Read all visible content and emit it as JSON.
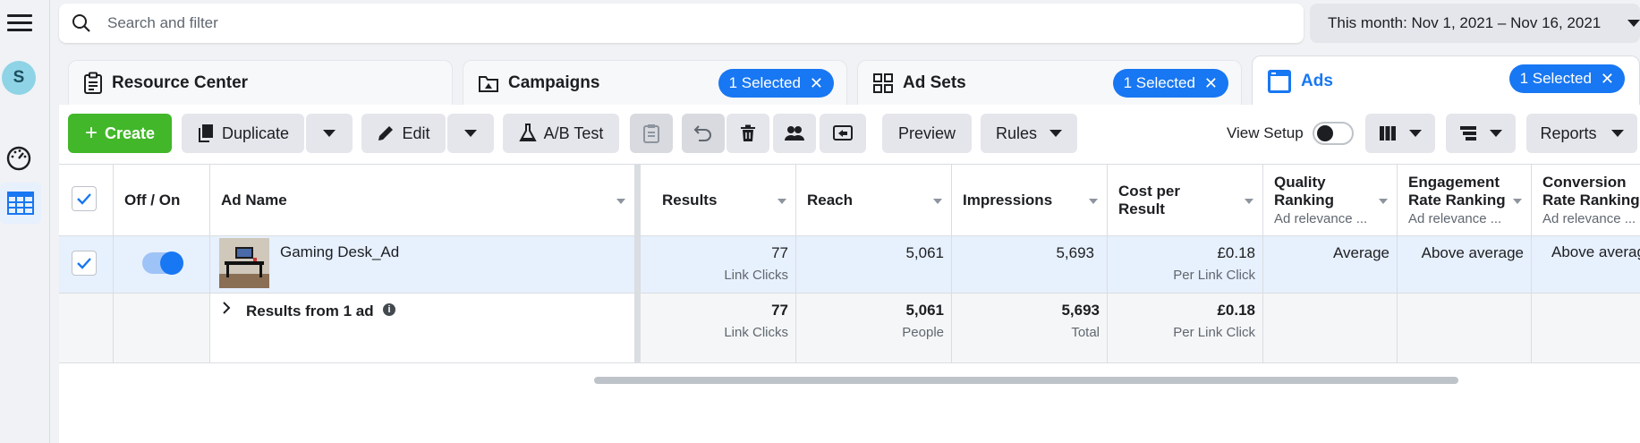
{
  "search": {
    "placeholder": "Search and filter"
  },
  "date_range": "This month: Nov 1, 2021 – Nov 16, 2021",
  "rail": {
    "avatar_letter": "S"
  },
  "tabs": [
    {
      "label": "Resource Center",
      "icon": "clipboard-icon"
    },
    {
      "label": "Campaigns",
      "icon": "folder-icon",
      "selected": "1 Selected"
    },
    {
      "label": "Ad Sets",
      "icon": "grid-icon",
      "selected": "1 Selected"
    },
    {
      "label": "Ads",
      "icon": "ad-icon",
      "selected": "1 Selected",
      "active": true
    }
  ],
  "toolbar": {
    "create": "Create",
    "duplicate": "Duplicate",
    "edit": "Edit",
    "ab_test": "A/B Test",
    "preview": "Preview",
    "rules": "Rules",
    "view_setup": "View Setup",
    "reports": "Reports"
  },
  "columns": {
    "off_on": "Off / On",
    "ad_name": "Ad Name",
    "results": "Results",
    "reach": "Reach",
    "impressions": "Impressions",
    "cost_per_result_1": "Cost per",
    "cost_per_result_2": "Result",
    "quality_1": "Quality",
    "quality_2": "Ranking",
    "quality_sub": "Ad relevance ...",
    "engagement_1": "Engagement",
    "engagement_2": "Rate Ranking",
    "engagement_sub": "Ad relevance ...",
    "conversion_1": "Conversion",
    "conversion_2": "Rate Ranking",
    "conversion_sub": "Ad relevance ..."
  },
  "row": {
    "ad_name": "Gaming Desk_Ad",
    "results": "77",
    "results_unit": "Link Clicks",
    "reach": "5,061",
    "impressions": "5,693",
    "cost": "£0.18",
    "cost_unit": "Per Link Click",
    "quality": "Average",
    "engagement": "Above average",
    "conversion": "Above average",
    "toggle_on": true
  },
  "summary": {
    "label": "Results from 1 ad",
    "results": "77",
    "results_unit": "Link Clicks",
    "reach": "5,061",
    "reach_unit": "People",
    "impressions": "5,693",
    "impressions_unit": "Total",
    "cost": "£0.18",
    "cost_unit": "Per Link Click"
  },
  "colors": {
    "primary": "#1877f2",
    "create": "#42b72a",
    "selected_row": "#e7f0fd"
  }
}
